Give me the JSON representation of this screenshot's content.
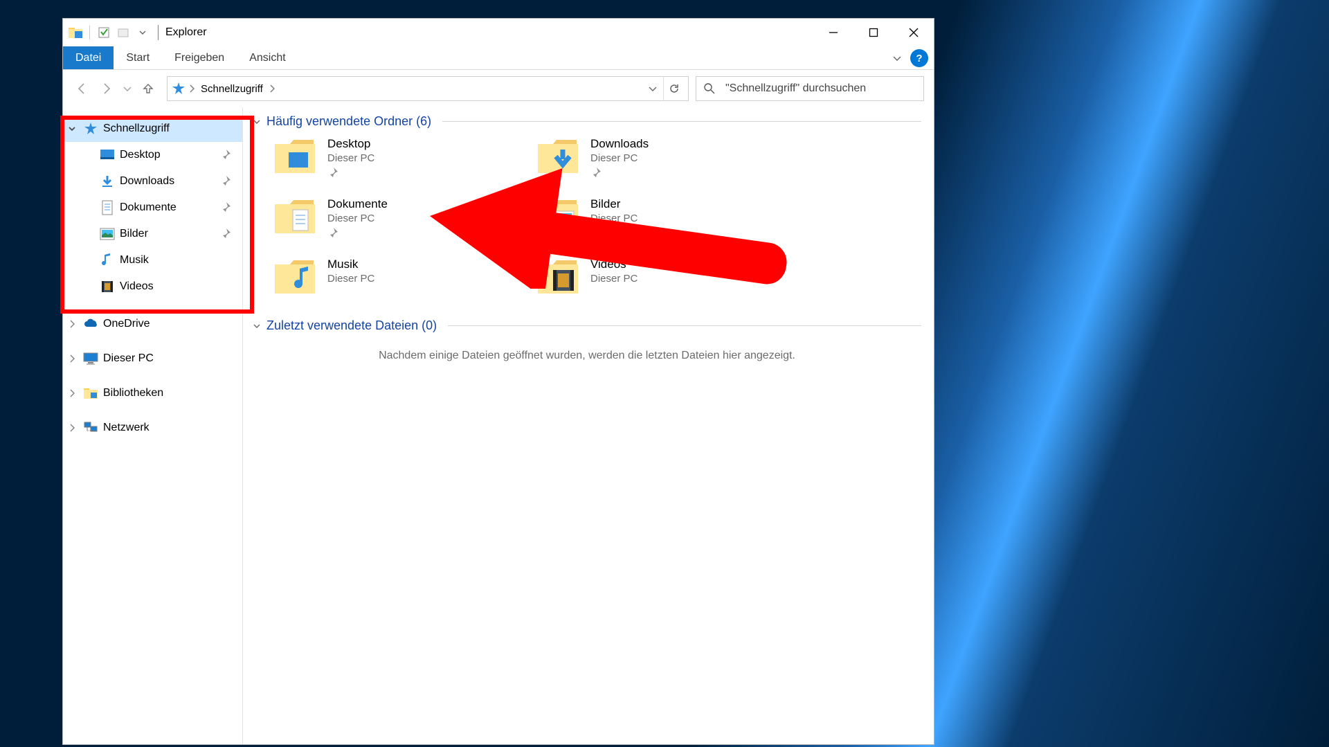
{
  "window": {
    "title": "Explorer"
  },
  "ribbon": {
    "file_label": "Datei",
    "tabs": [
      "Start",
      "Freigeben",
      "Ansicht"
    ],
    "help_text": "?"
  },
  "address": {
    "crumb_label": "Schnellzugriff"
  },
  "search": {
    "placeholder": "\"Schnellzugriff\" durchsuchen"
  },
  "tree": {
    "quick_access": {
      "label": "Schnellzugriff",
      "children": [
        {
          "label": "Desktop",
          "icon": "desktop",
          "pinned": true
        },
        {
          "label": "Downloads",
          "icon": "downloads",
          "pinned": true
        },
        {
          "label": "Dokumente",
          "icon": "documents",
          "pinned": true
        },
        {
          "label": "Bilder",
          "icon": "pictures",
          "pinned": true
        },
        {
          "label": "Musik",
          "icon": "music",
          "pinned": false
        },
        {
          "label": "Videos",
          "icon": "videos",
          "pinned": false
        }
      ]
    },
    "roots": [
      {
        "label": "OneDrive",
        "icon": "onedrive"
      },
      {
        "label": "Dieser PC",
        "icon": "thispc"
      },
      {
        "label": "Bibliotheken",
        "icon": "libraries"
      },
      {
        "label": "Netzwerk",
        "icon": "network"
      }
    ]
  },
  "main": {
    "group_folders": {
      "title_a": "Häufig verwendete Ordner",
      "title_b": "(6)",
      "items": [
        {
          "name": "Desktop",
          "sub": "Dieser PC",
          "icon": "desktop"
        },
        {
          "name": "Downloads",
          "sub": "Dieser PC",
          "icon": "downloads"
        },
        {
          "name": "Dokumente",
          "sub": "Dieser PC",
          "icon": "documents"
        },
        {
          "name": "Bilder",
          "sub": "Dieser PC",
          "icon": "pictures"
        },
        {
          "name": "Musik",
          "sub": "Dieser PC",
          "icon": "music"
        },
        {
          "name": "Videos",
          "sub": "Dieser PC",
          "icon": "videos"
        }
      ]
    },
    "group_recent": {
      "title_a": "Zuletzt verwendete Dateien",
      "title_b": "(0)",
      "empty_hint": "Nachdem einige Dateien geöffnet wurden, werden die letzten Dateien hier angezeigt."
    }
  }
}
